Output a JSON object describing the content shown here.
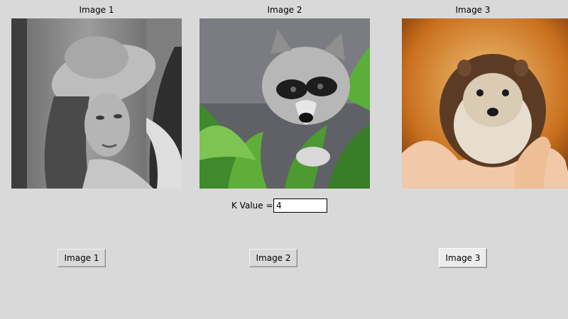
{
  "images": [
    {
      "title": "Image 1",
      "subject": "grayscale portrait of woman in hat"
    },
    {
      "title": "Image 2",
      "subject": "raccoon among green leaves"
    },
    {
      "title": "Image 3",
      "subject": "hedgehog held in hand"
    }
  ],
  "k_field": {
    "label": "K Value =",
    "value": "4"
  },
  "buttons": [
    {
      "label": "Image 1"
    },
    {
      "label": "Image 2"
    },
    {
      "label": "Image 3"
    }
  ]
}
